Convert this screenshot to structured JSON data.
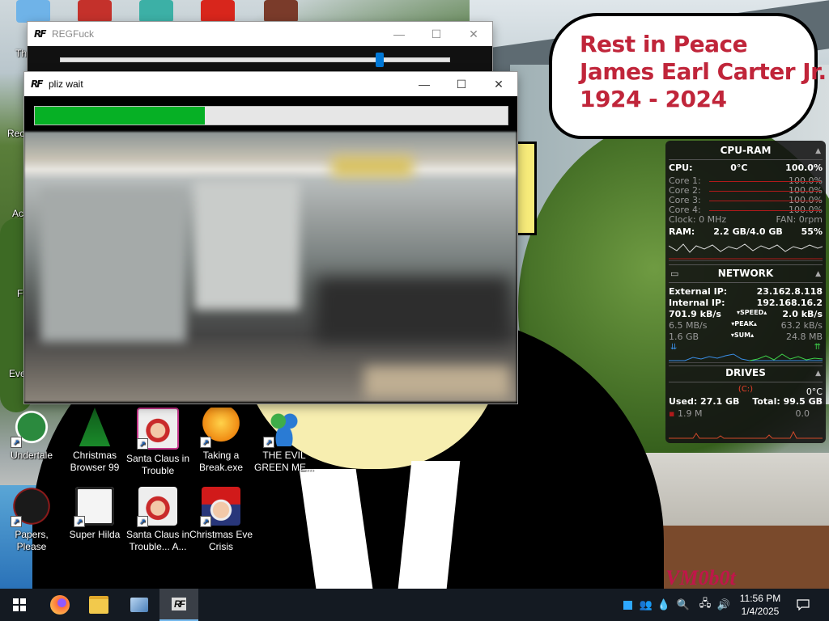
{
  "bubble": {
    "line1": "Rest in Peace",
    "line2": "James Earl Carter Jr.",
    "line3": "1924 - 2024"
  },
  "watermark": "VM0b0t",
  "partial_labels": {
    "top_left": "Th",
    "recycle": "Rec",
    "ac": "Ac",
    "fi": "Fi",
    "eve": "Eve"
  },
  "desktop_icons": [
    {
      "label": "Undertale",
      "icon": "undertale-icon"
    },
    {
      "label": "Christmas Browser 99",
      "icon": "christmas-tree-icon"
    },
    {
      "label": "Santa Claus in Trouble",
      "icon": "santa-icon"
    },
    {
      "label": "Taking a Break.exe",
      "icon": "break-icon"
    },
    {
      "label": "THE EVIL GREEN ME...",
      "icon": "msn-people-icon"
    },
    {
      "label": "Papers, Please",
      "icon": "papers-please-icon"
    },
    {
      "label": "Super Hilda",
      "icon": "hilda-icon"
    },
    {
      "label": "Santa Claus in Trouble... A...",
      "icon": "santa-icon"
    },
    {
      "label": "Christmas Eve Crisis",
      "icon": "santa-hat-icon"
    }
  ],
  "regfuck_window": {
    "title": "REGFuck",
    "logo": "RF",
    "slider_value": 0.82
  },
  "wait_window": {
    "title": "pliz wait",
    "logo": "RF",
    "progress": 0.36
  },
  "window_controls": {
    "minimize": "—",
    "maximize": "☐",
    "close": "✕"
  },
  "gadget": {
    "cpu_ram": {
      "title": "CPU-RAM",
      "cpu_label": "CPU:",
      "cpu_temp": "0°C",
      "cpu_usage": "100.0%",
      "cores": [
        {
          "label": "Core 1:",
          "value": "100.0%"
        },
        {
          "label": "Core 2:",
          "value": "100.0%"
        },
        {
          "label": "Core 3:",
          "value": "100.0%"
        },
        {
          "label": "Core 4:",
          "value": "100.0%"
        }
      ],
      "clock": "Clock: 0 MHz",
      "fan": "FAN: 0rpm",
      "ram_label": "RAM:",
      "ram_value": "2.2 GB/4.0 GB",
      "ram_pct": "55%"
    },
    "network": {
      "title": "NETWORK",
      "external_label": "External IP:",
      "external_ip": "23.162.8.118",
      "internal_label": "Internal IP:",
      "internal_ip": "192.168.16.2",
      "speed_down": "701.9 kB/s",
      "speed_label": "SPEED",
      "speed_up": "2.0 kB/s",
      "peak_down": "6.5 MB/s",
      "peak_label": "PEAK",
      "peak_up": "63.2 kB/s",
      "sum_down": "1.6 GB",
      "sum_label": "SUM",
      "sum_up": "24.8 MB"
    },
    "drives": {
      "title": "DRIVES",
      "drive_letter": "(C:)",
      "temp": "0°C",
      "used": "Used: 27.1 GB",
      "total": "Total: 99.5 GB",
      "read": "1.9 M",
      "write": "0.0"
    }
  },
  "taskbar": {
    "apps": [
      "start-icon",
      "firefox-icon",
      "file-explorer-icon",
      "control-panel-icon",
      "regfuck-icon"
    ],
    "time": "11:56 PM",
    "date": "1/4/2025"
  }
}
